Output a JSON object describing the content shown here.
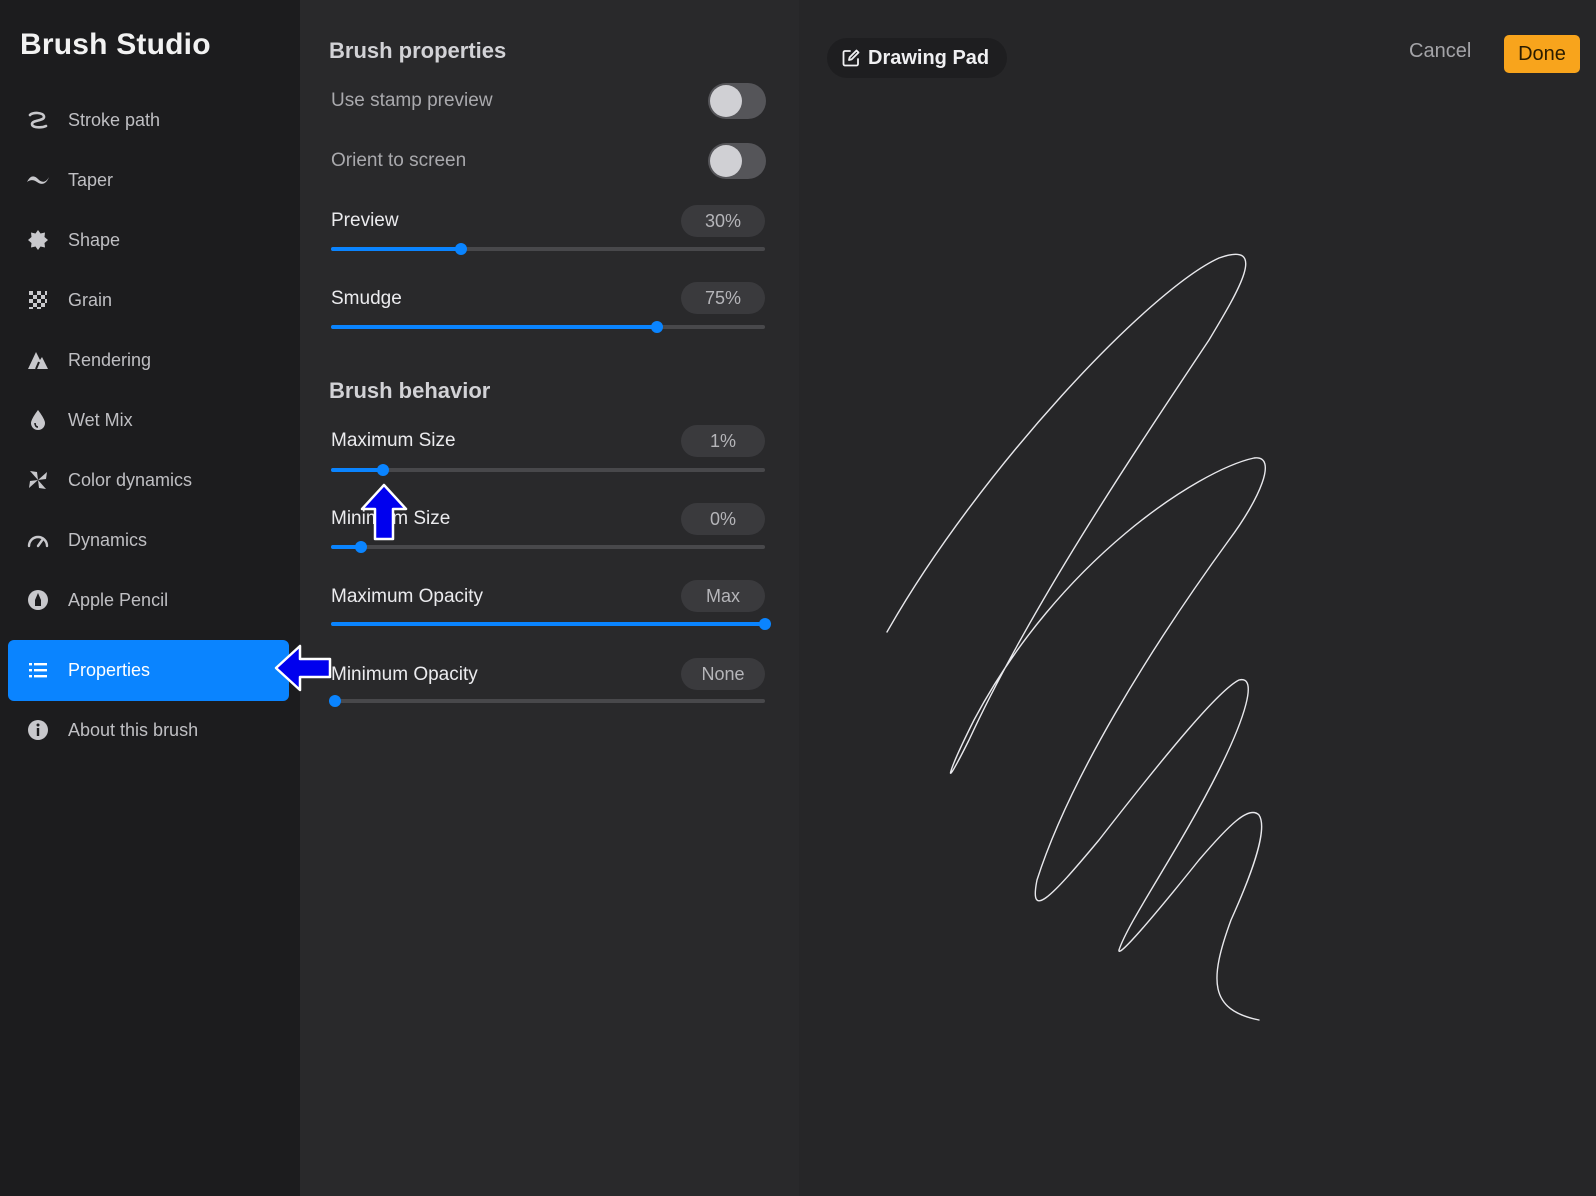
{
  "sidebar": {
    "title": "Brush Studio",
    "items": [
      {
        "label": "Stroke path",
        "icon": "stroke-path-icon",
        "active": false
      },
      {
        "label": "Taper",
        "icon": "taper-icon",
        "active": false
      },
      {
        "label": "Shape",
        "icon": "shape-icon",
        "active": false
      },
      {
        "label": "Grain",
        "icon": "grain-icon",
        "active": false
      },
      {
        "label": "Rendering",
        "icon": "rendering-icon",
        "active": false
      },
      {
        "label": "Wet Mix",
        "icon": "wet-mix-icon",
        "active": false
      },
      {
        "label": "Color dynamics",
        "icon": "color-dynamics-icon",
        "active": false
      },
      {
        "label": "Dynamics",
        "icon": "dynamics-icon",
        "active": false
      },
      {
        "label": "Apple Pencil",
        "icon": "apple-pencil-icon",
        "active": false
      },
      {
        "label": "Properties",
        "icon": "properties-icon",
        "active": true
      },
      {
        "label": "About this brush",
        "icon": "info-icon",
        "active": false
      }
    ]
  },
  "properties": {
    "title": "Brush properties",
    "use_stamp_preview": {
      "label": "Use stamp preview",
      "on": false
    },
    "orient_to_screen": {
      "label": "Orient to screen",
      "on": false
    },
    "preview": {
      "label": "Preview",
      "value": "30%",
      "fraction": 0.3
    },
    "smudge": {
      "label": "Smudge",
      "value": "75%",
      "fraction": 0.75
    }
  },
  "behavior": {
    "title": "Brush behavior",
    "max_size": {
      "label": "Maximum Size",
      "value": "1%",
      "fraction": 0.12
    },
    "min_size": {
      "label": "Minimum Size",
      "value": "0%",
      "fraction": 0.07
    },
    "max_opacity": {
      "label": "Maximum Opacity",
      "value": "Max",
      "fraction": 1.0
    },
    "min_opacity": {
      "label": "Minimum Opacity",
      "value": "None",
      "fraction": 0.01
    }
  },
  "canvas": {
    "drawing_pad_label": "Drawing Pad",
    "cancel_label": "Cancel",
    "done_label": "Done"
  },
  "colors": {
    "accent": "#0a84ff",
    "done": "#f8a41c",
    "annotation_arrow": "#0000ee"
  }
}
